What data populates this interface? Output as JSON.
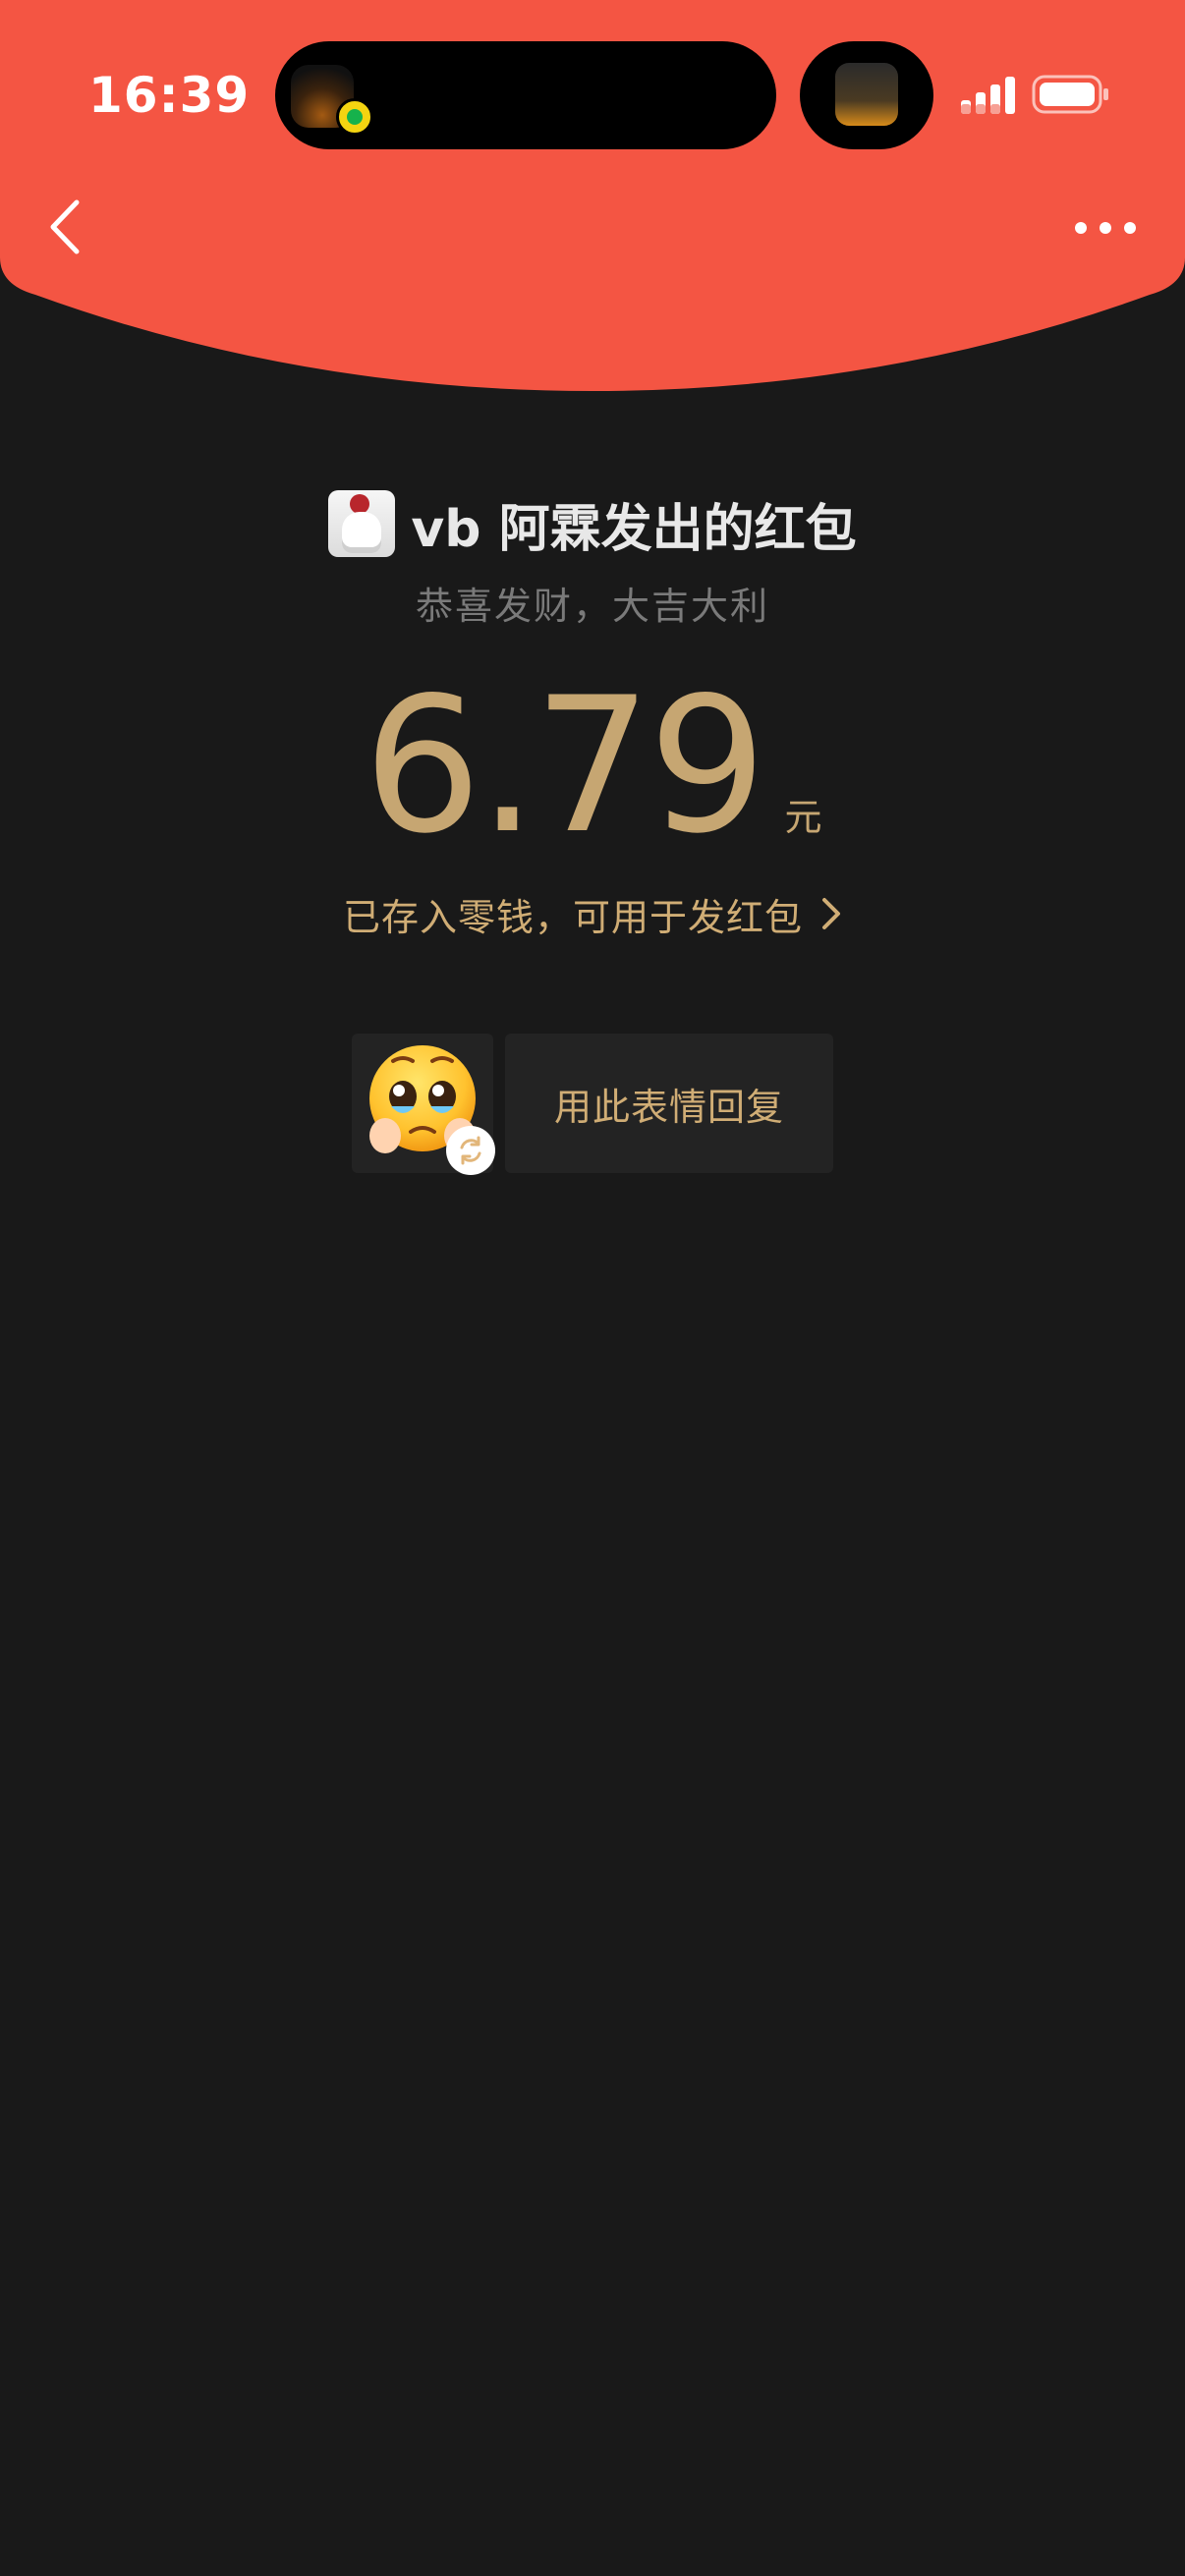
{
  "status_bar": {
    "time": "16:39"
  },
  "colors": {
    "header_red": "#f45543",
    "background": "#191919",
    "gold": "#c6a672",
    "muted_gray": "#7a7a7a"
  },
  "nav": {
    "back_icon": "chevron-left-icon",
    "more_icon": "more-dots-icon"
  },
  "packet": {
    "sender_title": "vb 阿霖发出的红包",
    "greeting": "恭喜发财，大吉大利",
    "amount": "6.79",
    "unit": "元",
    "saved_text": "已存入零钱，可用于发红包"
  },
  "reply": {
    "emoji_icon": "crying-face-emoji",
    "refresh_icon": "refresh-icon",
    "button_label": "用此表情回复"
  }
}
